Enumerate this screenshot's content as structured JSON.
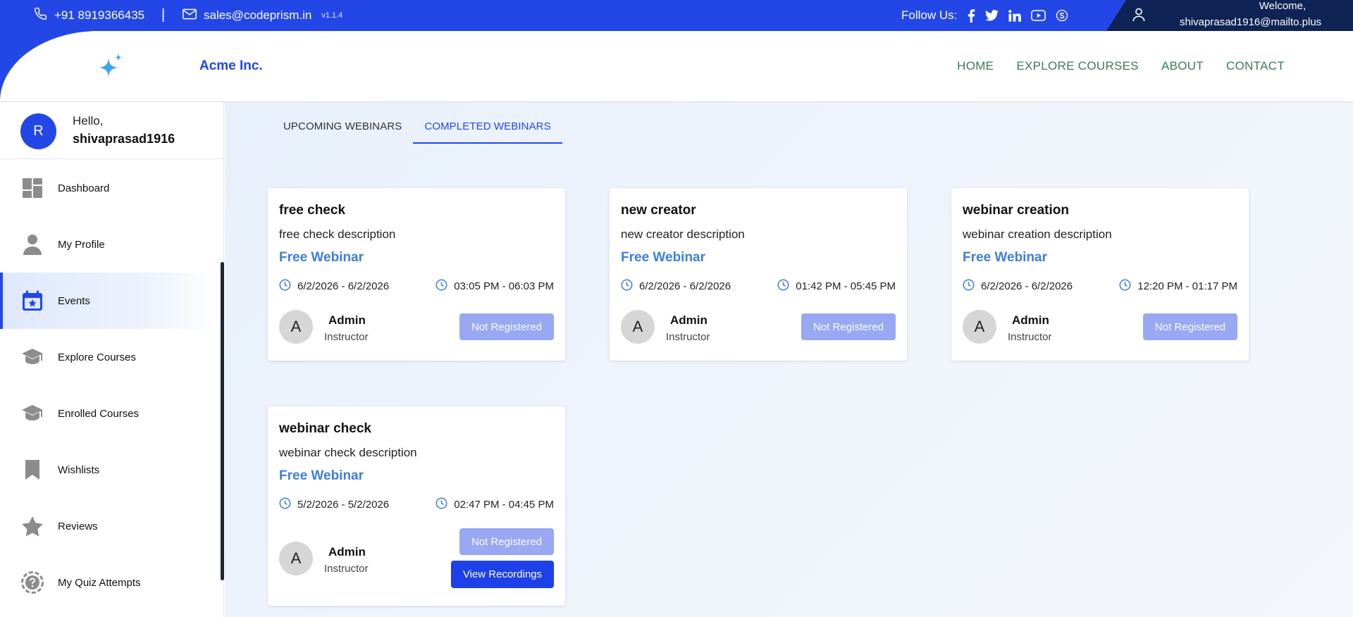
{
  "topbar": {
    "phone": "+91 8919366435",
    "separator": "|",
    "email": "sales@codeprism.in",
    "version": "v1.1.4",
    "follow_label": "Follow Us:",
    "socials": [
      "facebook-icon",
      "twitter-icon",
      "linkedin-icon",
      "youtube-icon",
      "skype-icon"
    ],
    "welcome_label": "Welcome,",
    "welcome_email": "shivaprasad1916@mailto.plus"
  },
  "header": {
    "brand": "Acme Inc.",
    "nav": [
      "HOME",
      "EXPLORE COURSES",
      "ABOUT",
      "CONTACT"
    ]
  },
  "sidebar": {
    "avatar_letter": "R",
    "hello": "Hello,",
    "username": "shivaprasad1916",
    "items": [
      {
        "label": "Dashboard",
        "icon": "dashboard-icon"
      },
      {
        "label": "My Profile",
        "icon": "person-icon"
      },
      {
        "label": "Events",
        "icon": "calendar-star-icon",
        "active": true
      },
      {
        "label": "Explore Courses",
        "icon": "graduation-cap-icon"
      },
      {
        "label": "Enrolled Courses",
        "icon": "graduation-cap-icon"
      },
      {
        "label": "Wishlists",
        "icon": "bookmark-icon"
      },
      {
        "label": "Reviews",
        "icon": "star-icon"
      },
      {
        "label": "My Quiz Attempts",
        "icon": "quiz-icon"
      }
    ]
  },
  "tabs": [
    {
      "label": "UPCOMING WEBINARS",
      "active": false
    },
    {
      "label": "COMPLETED WEBINARS",
      "active": true
    }
  ],
  "webinars": [
    {
      "title": "free check",
      "description": "free check description",
      "type": "Free Webinar",
      "dates": "6/2/2026 - 6/2/2026",
      "times": "03:05 PM - 06:03 PM",
      "instructor_initial": "A",
      "instructor": "Admin",
      "role": "Instructor",
      "status": "Not Registered"
    },
    {
      "title": "new creator",
      "description": "new creator description",
      "type": "Free Webinar",
      "dates": "6/2/2026 - 6/2/2026",
      "times": "01:42 PM - 05:45 PM",
      "instructor_initial": "A",
      "instructor": "Admin",
      "role": "Instructor",
      "status": "Not Registered"
    },
    {
      "title": "webinar creation",
      "description": "webinar creation description",
      "type": "Free Webinar",
      "dates": "6/2/2026 - 6/2/2026",
      "times": "12:20 PM - 01:17 PM",
      "instructor_initial": "A",
      "instructor": "Admin",
      "role": "Instructor",
      "status": "Not Registered"
    },
    {
      "title": "webinar check",
      "description": "webinar check description",
      "type": "Free Webinar",
      "dates": "5/2/2026 - 5/2/2026",
      "times": "02:47 PM - 04:45 PM",
      "instructor_initial": "A",
      "instructor": "Admin",
      "role": "Instructor",
      "status": "Not Registered",
      "recordings_label": "View Recordings"
    }
  ],
  "colors": {
    "primary": "#2347e6",
    "dark_navy": "#0f2454",
    "nav_green": "#3b7a57",
    "link_blue": "#3f7ed6",
    "disabled_button": "#98a8f2"
  }
}
